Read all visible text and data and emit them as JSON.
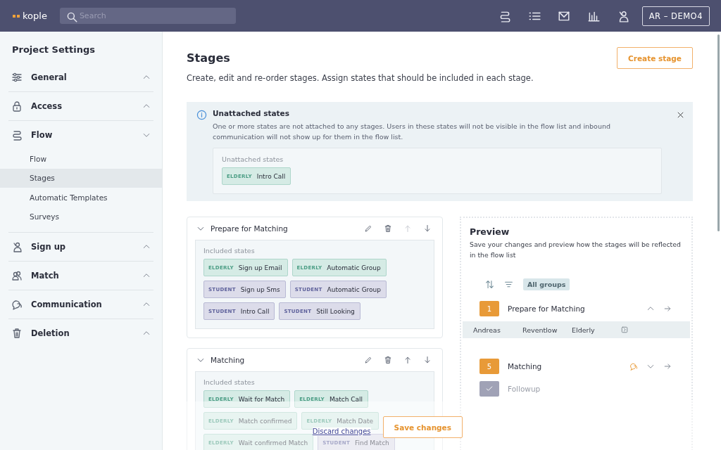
{
  "topbar": {
    "logo": "kople",
    "search": {
      "placeholder": "Search"
    },
    "account": "AR – DEMO4"
  },
  "sidebar": {
    "title": "Project Settings",
    "sections": [
      {
        "label": "General",
        "expanded": false
      },
      {
        "label": "Access",
        "expanded": false
      },
      {
        "label": "Flow",
        "expanded": true,
        "children": [
          {
            "label": "Flow",
            "selected": false
          },
          {
            "label": "Stages",
            "selected": true
          },
          {
            "label": "Automatic Templates",
            "selected": false
          },
          {
            "label": "Surveys",
            "selected": false
          }
        ]
      },
      {
        "label": "Sign up",
        "expanded": false
      },
      {
        "label": "Match",
        "expanded": false
      },
      {
        "label": "Communication",
        "expanded": false
      },
      {
        "label": "Deletion",
        "expanded": false
      }
    ]
  },
  "page": {
    "title": "Stages",
    "description": "Create, edit and re-order stages. Assign states that should be included in each stage.",
    "create_button": "Create stage"
  },
  "alert": {
    "title": "Unattached states",
    "text": "One or more states are not attached to any stages. Users in these states will not be visible in the flow list and inbound communication will not show up for them in the flow list.",
    "box_label": "Unattached states",
    "states": [
      {
        "kind": "elderly",
        "group": "ELDERLY",
        "name": "Intro Call"
      }
    ]
  },
  "stages": [
    {
      "name": "Prepare for Matching",
      "label": "Included states",
      "up_disabled": true,
      "states": [
        {
          "kind": "elderly",
          "group": "ELDERLY",
          "name": "Sign up Email"
        },
        {
          "kind": "elderly",
          "group": "ELDERLY",
          "name": "Automatic Group"
        },
        {
          "kind": "student",
          "group": "STUDENT",
          "name": "Sign up Sms"
        },
        {
          "kind": "student",
          "group": "STUDENT",
          "name": "Automatic Group"
        },
        {
          "kind": "student",
          "group": "STUDENT",
          "name": "Intro Call"
        },
        {
          "kind": "student",
          "group": "STUDENT",
          "name": "Still Looking"
        }
      ]
    },
    {
      "name": "Matching",
      "label": "Included states",
      "up_disabled": false,
      "states": [
        {
          "kind": "elderly",
          "group": "ELDERLY",
          "name": "Wait for Match"
        },
        {
          "kind": "elderly",
          "group": "ELDERLY",
          "name": "Match Call"
        },
        {
          "kind": "elderly",
          "group": "ELDERLY",
          "name": "Match confirmed"
        },
        {
          "kind": "elderly",
          "group": "ELDERLY",
          "name": "Match Date"
        },
        {
          "kind": "elderly",
          "group": "ELDERLY",
          "name": "Wait confirmed Match"
        },
        {
          "kind": "student",
          "group": "STUDENT",
          "name": "Find Match"
        }
      ]
    }
  ],
  "save_bar": {
    "discard": "Discard changes",
    "save": "Save changes"
  },
  "preview": {
    "title": "Preview",
    "text": "Save your changes and preview how the stages will be reflected in the flow list",
    "filter": "All groups",
    "stages": [
      {
        "kind": "number",
        "badge": "1",
        "name": "Prepare for Matching",
        "expanded": true,
        "chat": false,
        "rows": [
          {
            "first": "Andreas",
            "last": "Reventlow",
            "group": "Elderly"
          }
        ]
      },
      {
        "kind": "number",
        "badge": "5",
        "name": "Matching",
        "expanded": false,
        "chat": true
      },
      {
        "kind": "done",
        "name": "Followup"
      }
    ]
  }
}
